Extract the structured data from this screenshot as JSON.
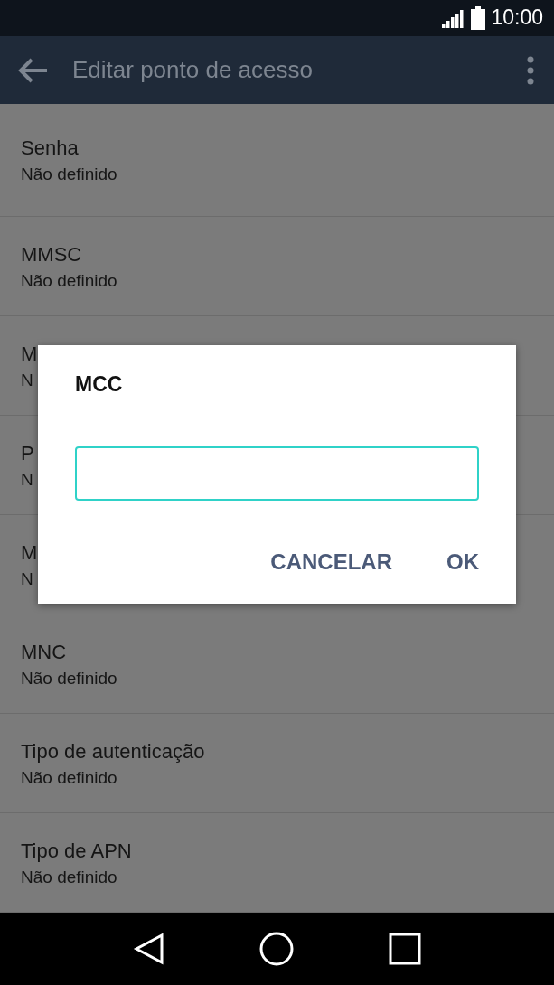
{
  "status_bar": {
    "time": "10:00"
  },
  "toolbar": {
    "title": "Editar ponto de acesso"
  },
  "settings": [
    {
      "title": "Senha",
      "summary": "Não definido"
    },
    {
      "title": "MMSC",
      "summary": "Não definido"
    },
    {
      "title": "M",
      "summary": "N"
    },
    {
      "title": "P",
      "summary": "N"
    },
    {
      "title": "M",
      "summary": "N"
    },
    {
      "title": "MNC",
      "summary": "Não definido"
    },
    {
      "title": "Tipo de autenticação",
      "summary": "Não definido"
    },
    {
      "title": "Tipo de APN",
      "summary": "Não definido"
    }
  ],
  "dialog": {
    "title": "MCC",
    "buttons": [
      "CANCELAR",
      "OK"
    ]
  }
}
